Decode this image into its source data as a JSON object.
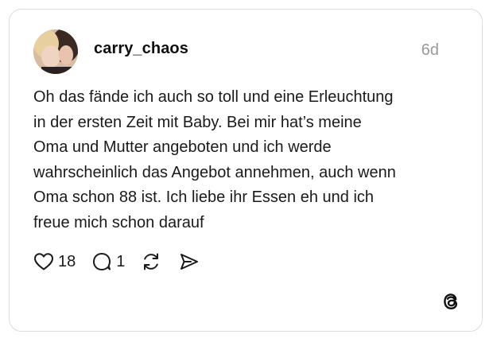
{
  "post": {
    "username": "carry_chaos",
    "timestamp": "6d",
    "text_lines": [
      "Oh das fände ich auch so toll und eine Erleuchtung",
      "in der ersten Zeit mit Baby. Bei mir hat’s meine",
      "Oma und Mutter angeboten und ich werde",
      "wahrscheinlich das Angebot annehmen, auch wenn",
      "Oma schon 88 ist. Ich liebe ihr Essen eh und ich",
      "freue mich schon darauf"
    ]
  },
  "actions": {
    "likes": "18",
    "replies": "1",
    "icons": [
      "heart-icon",
      "comment-icon",
      "repost-icon",
      "share-icon"
    ]
  },
  "branding": {
    "logo": "threads-logo-icon"
  },
  "colors": {
    "text": "#101010",
    "muted": "#9a9a9a",
    "border": "#dcdcdc"
  }
}
